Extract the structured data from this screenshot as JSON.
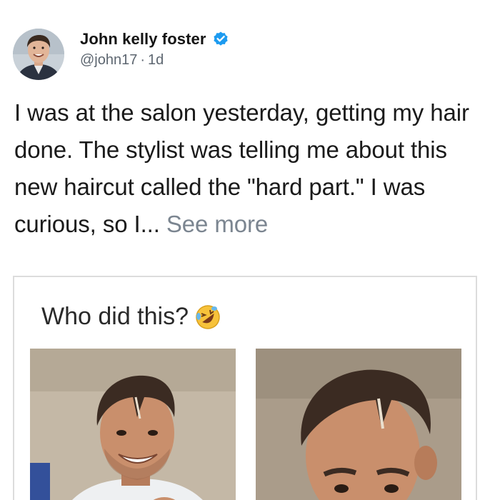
{
  "post": {
    "author_name": "John kelly foster",
    "handle": "@john17",
    "separator": "·",
    "time_ago": "1d",
    "text": "I was at the salon yesterday, getting my hair done. The stylist was telling me about this new haircut called the \"hard part.\" I was curious, so I...",
    "see_more_label": "See more"
  },
  "card": {
    "caption": "Who did this?",
    "emoji": "rolling-on-floor-laughing-emoji"
  },
  "icons": {
    "avatar": "profile-photo",
    "verified": "verified-badge-icon"
  },
  "colors": {
    "verified_blue": "#1d9bf0",
    "secondary_text": "#5d6670",
    "see_more": "#7b8590"
  }
}
